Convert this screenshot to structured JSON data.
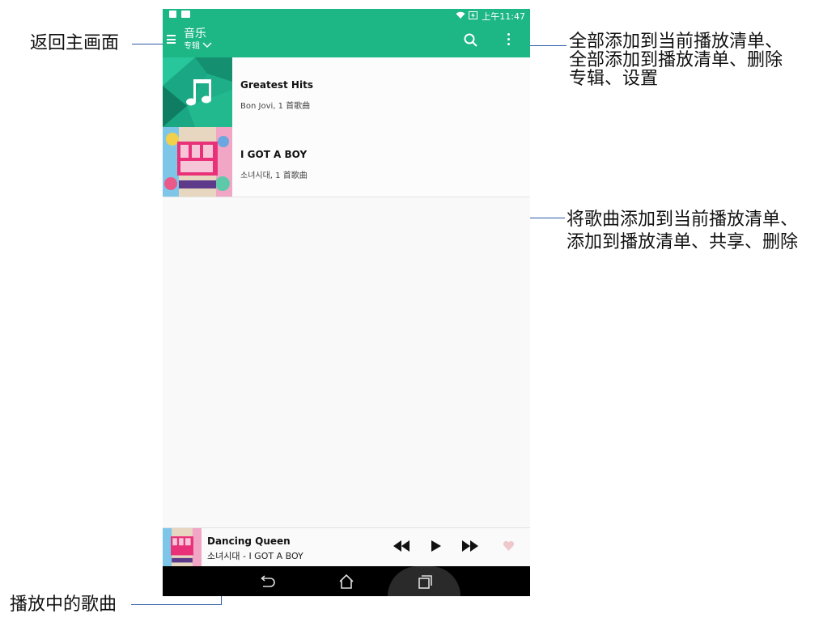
{
  "statusbar": {
    "time": "上午11:47"
  },
  "appbar": {
    "title": "音乐",
    "subtitle": "专辑"
  },
  "albums": [
    {
      "title": "Greatest Hits",
      "meta": "Bon Jovi, 1 首歌曲"
    },
    {
      "title": "I GOT A BOY",
      "meta": "소녀시대, 1 首歌曲"
    }
  ],
  "now_playing": {
    "title": "Dancing Queen",
    "subtitle": "소녀시대 - I GOT A BOY"
  },
  "annotations": {
    "home": "返回主画面",
    "menu_line1": "全部添加到当前播放清单、",
    "menu_line2": "全部添加到播放清单、删除",
    "menu_line3": "专辑、设置",
    "song_line1": "将歌曲添加到当前播放清单、",
    "song_line2": "添加到播放清单、共享、删除",
    "playing": "播放中的歌曲"
  },
  "colors": {
    "accent": "#1db685",
    "annotation_line": "#2a5aa8",
    "heart": "#f0c8cc"
  }
}
